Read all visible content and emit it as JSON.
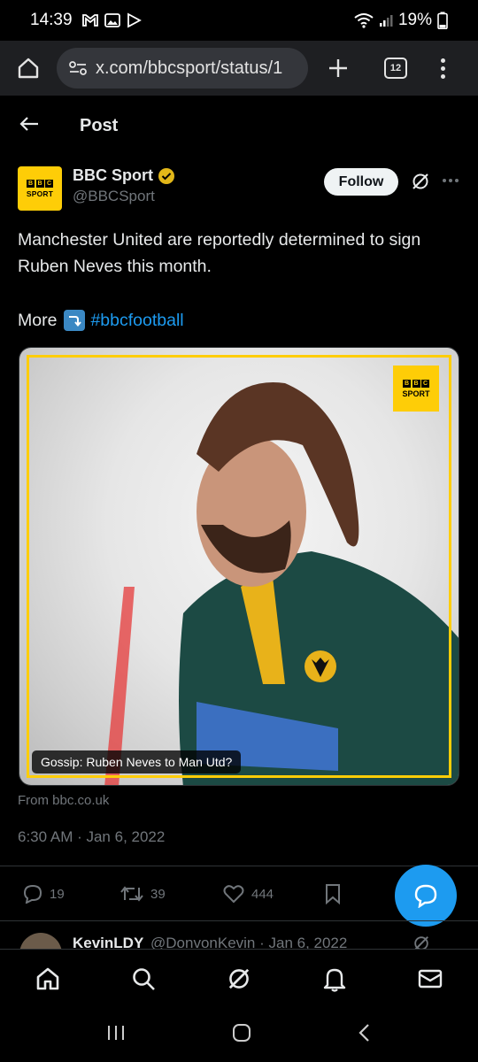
{
  "status_bar": {
    "time": "14:39",
    "battery": "19%",
    "notification_icons": [
      "gmail-icon",
      "gallery-icon",
      "play-store-icon"
    ]
  },
  "browser": {
    "url": "x.com/bbcsport/status/1",
    "tab_count": "12"
  },
  "header": {
    "title": "Post"
  },
  "post": {
    "author_name": "BBC Sport",
    "author_handle": "@BBCSport",
    "follow_label": "Follow",
    "text": "Manchester United are reportedly determined to sign Ruben Neves this month.",
    "more_label": "More",
    "hashtag": "#bbcfootball",
    "media_caption": "Gossip: Ruben Neves to Man Utd?",
    "from_link": "From bbc.co.uk",
    "timestamp": "6:30 AM · Jan 6, 2022",
    "replies": "19",
    "reposts": "39",
    "likes": "444",
    "logo_letters": [
      "B",
      "B",
      "C"
    ],
    "logo_sport": "SPORT"
  },
  "reply_preview": {
    "name": "KevinLDY",
    "handle": "@DonvonKevin · Jan 6, 2022"
  },
  "colors": {
    "accent": "#1d9bf0",
    "bbc_yellow": "#fecd07",
    "background": "#000000",
    "muted": "#71767b"
  }
}
